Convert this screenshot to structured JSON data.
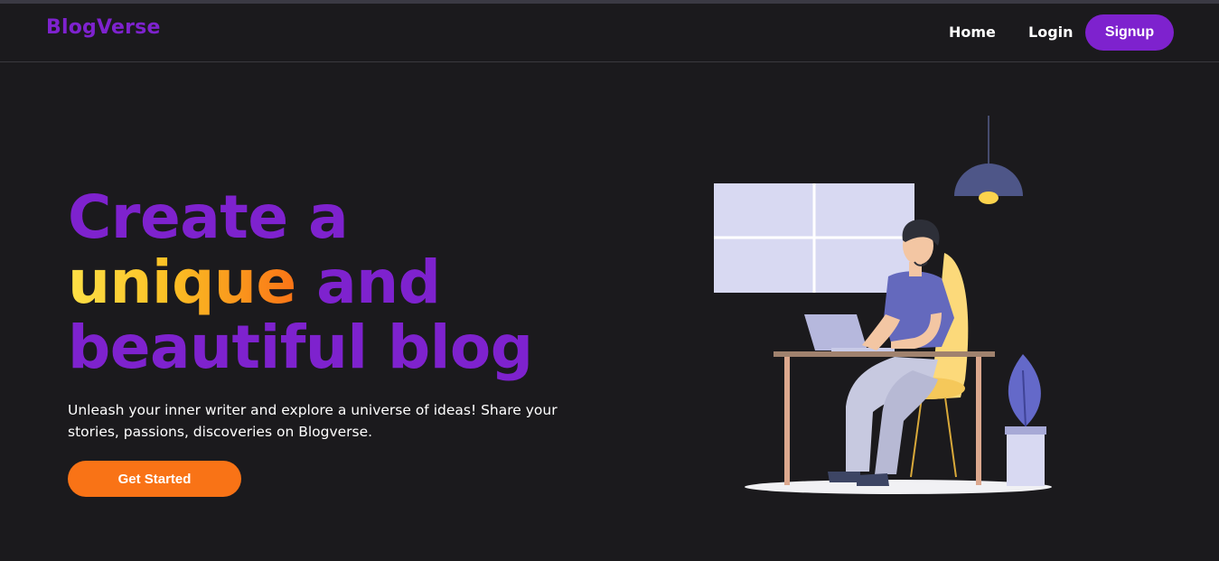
{
  "brand": {
    "name": "BlogVerse",
    "color": "#7e22ce"
  },
  "nav": {
    "home_label": "Home",
    "login_label": "Login",
    "signup_label": "Signup"
  },
  "hero": {
    "title_line1": "Create a",
    "title_accent": "unique",
    "title_line2_rest": " and",
    "title_line3": "beautiful blog",
    "description": "Unleash your inner writer and explore a universe of ideas! Share your stories, passions, discoveries on Blogverse.",
    "cta_label": "Get Started"
  },
  "colors": {
    "background": "#1b1a1d",
    "primary": "#7e22ce",
    "cta": "#f97316",
    "accent_gradient_start": "#fde047",
    "accent_gradient_end": "#f97316"
  },
  "illustration": {
    "icon": "person-at-desk-illustration"
  }
}
